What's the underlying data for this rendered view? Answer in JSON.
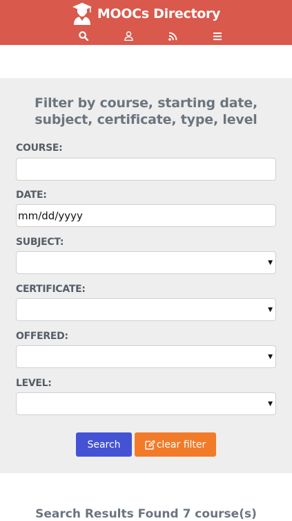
{
  "header": {
    "title": "MOOCs Directory",
    "logo_icon": "graduate-icon",
    "background": "#d9594c",
    "nav": [
      {
        "icon": "search-icon"
      },
      {
        "icon": "user-icon"
      },
      {
        "icon": "rss-icon"
      },
      {
        "icon": "menu-icon"
      }
    ]
  },
  "filter": {
    "title_line1": "Filter by course, starting date,",
    "title_line2": "subject, certificate, type, level",
    "course": {
      "label": "COURSE:",
      "value": ""
    },
    "date": {
      "label": "DATE:",
      "value": "mm/dd/yyyy"
    },
    "subject": {
      "label": "SUBJECT:",
      "value": ""
    },
    "certificate": {
      "label": "CERTIFICATE:",
      "value": ""
    },
    "offered": {
      "label": "OFFERED:",
      "value": ""
    },
    "level": {
      "label": "LEVEL:",
      "value": ""
    },
    "search_button": "Search",
    "clear_button": "clear filter",
    "search_color": "#4453d4",
    "clear_color": "#f27b2a"
  },
  "results": {
    "heading": "Search Results Found 7 course(s)"
  }
}
